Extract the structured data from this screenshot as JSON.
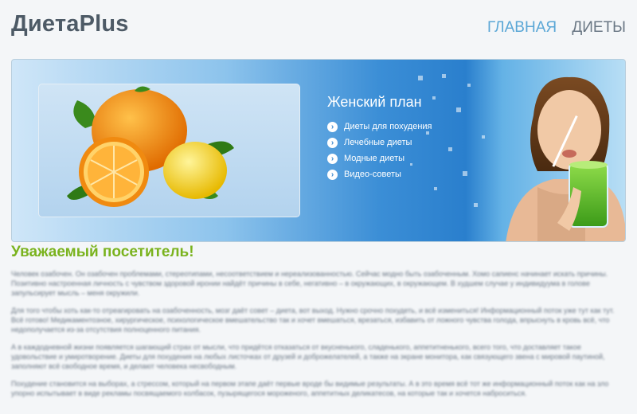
{
  "header": {
    "logo": "ДиетаPlus",
    "nav": [
      {
        "label": "ГЛАВНАЯ"
      },
      {
        "label": "ДИЕТЫ"
      }
    ]
  },
  "banner": {
    "plan_title": "Женский план",
    "items": [
      {
        "label": "Диеты для похудения"
      },
      {
        "label": "Лечебные диеты"
      },
      {
        "label": "Модные диеты"
      },
      {
        "label": "Видео-советы"
      }
    ],
    "arrow_icon": "arrow-right-circle-icon"
  },
  "content": {
    "heading": "Уважаемый посетитель!",
    "paragraphs": [
      "Человек озабочен. Он озабочен проблемами, стереотипами, несоответствием и нереализованностью. Сейчас модно быть озабоченным. Хомо сапиенс начинает искать причины. Позитивно настроенная личность с чувством здоровой иронии найдёт причины в себе, негативно – в окружающих, в окружающем. В худшем случае у индивидуума в голове запульсирует мысль – меня окружили.",
      "Для того чтобы хоть как-то отреагировать на озабоченность, мозг даёт совет – диета, вот выход. Нужно срочно похудеть, и всё измениться! Информационный поток уже тут как тут. Всё готово! Медикаментозное, хирургическое, психологическое вмешательство так и хочет вмешаться, врезаться, избавить от ложного чувства голода, впрыснуть в кровь всё, что недополучается из-за отсутствия полноценного питания.",
      "А в каждодневной жизни появляется шагающий страх от мысли, что придётся отказаться от вкусненького, сладенького, аппетитненького, всего того, что доставляет такое удовольствие и умиротворение. Диеты для похудения на любых листочках от друзей и доброжелателей, а также на экране монитора, как связующего звена с мировой паутиной, заполняют всё свободное время, и делают человека несвободным.",
      "Похудение становится на выборах, а стрессом, который на первом этапе даёт первые вроде бы видимые результаты. А в это время всё тот же информационный поток как на зло упорно испытывает в виде рекламы посвящаемого колбасок, пузырящегося мороженого, аппетитных деликатесов, на которые так и хочется наброситься."
    ]
  }
}
